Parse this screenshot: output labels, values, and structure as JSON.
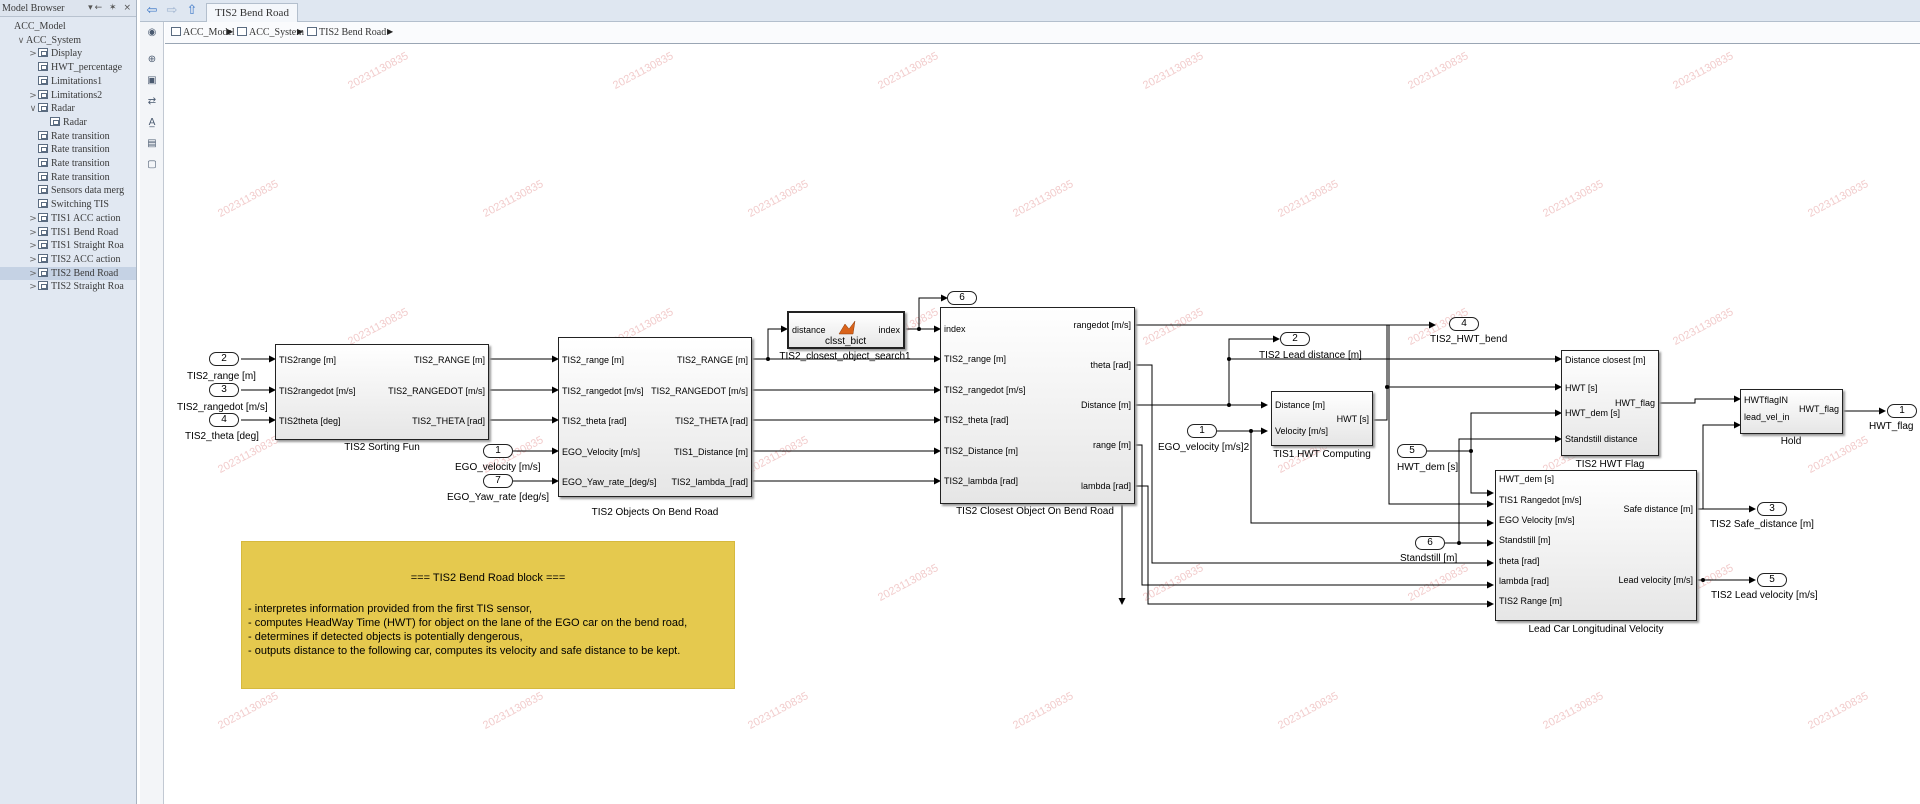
{
  "browser": {
    "title": "Model Browser",
    "controls": "▾← ✶ ×",
    "items": [
      {
        "label": "ACC_Model",
        "arrow": ""
      },
      {
        "label": "ACC_System",
        "arrow": "∨"
      },
      {
        "label": "Display",
        "arrow": ">"
      },
      {
        "label": "HWT_percentage",
        "arrow": ""
      },
      {
        "label": "Limitations1",
        "arrow": ""
      },
      {
        "label": "Limitations2",
        "arrow": ">"
      },
      {
        "label": "Radar",
        "arrow": "∨"
      },
      {
        "label": "Radar",
        "arrow": ""
      },
      {
        "label": "Rate transition",
        "arrow": ""
      },
      {
        "label": "Rate transition",
        "arrow": ""
      },
      {
        "label": "Rate transition",
        "arrow": ""
      },
      {
        "label": "Rate transition",
        "arrow": ""
      },
      {
        "label": "Sensors data merg",
        "arrow": ""
      },
      {
        "label": "Switching TIS",
        "arrow": ""
      },
      {
        "label": "TIS1 ACC action",
        "arrow": ">"
      },
      {
        "label": "TIS1 Bend Road",
        "arrow": ">"
      },
      {
        "label": "TIS1 Straight Roa",
        "arrow": ">"
      },
      {
        "label": "TIS2 ACC action",
        "arrow": ">"
      },
      {
        "label": "TIS2 Bend Road",
        "arrow": ">"
      },
      {
        "label": "TIS2 Straight Roa",
        "arrow": ">"
      }
    ]
  },
  "toolbar": {
    "back_icon": "⇦",
    "forward_icon": "⇨",
    "up_icon": "⇧",
    "tab_label": "TIS2 Bend Road"
  },
  "breadcrumb": {
    "items": [
      "ACC_Model",
      "ACC_System",
      "TIS2 Bend Road"
    ],
    "sep": "▶"
  },
  "tools": [
    "◉",
    "⊕",
    "▣",
    "⇄",
    "A̲",
    "▤",
    "▢"
  ],
  "watermark": "20231130835",
  "blocks": {
    "sorting": {
      "name": "TIS2 Sorting Fun",
      "inputs": [
        "TIS2range [m]",
        "TIS2rangedot [m/s]",
        "TIS2theta [deg]"
      ],
      "outputs": [
        "TIS2_RANGE [m]",
        "TIS2_RANGEDOT [m/s]",
        "TIS2_THETA [rad]"
      ]
    },
    "objects": {
      "name": "TIS2 Objects On Bend Road",
      "inputs": [
        "TIS2_range [m]",
        "TIS2_rangedot [m/s]",
        "TIS2_theta [rad]",
        "EGO_Velocity [m/s]",
        "EGO_Yaw_rate_[deg/s]"
      ],
      "outputs": [
        "TIS2_RANGE [m]",
        "TIS2_RANGEDOT [m/s]",
        "TIS2_THETA [rad]",
        "TIS1_Distance [m]",
        "TIS2_lambda_[rad]"
      ]
    },
    "search": {
      "name": "TIS2_closest_object_search1",
      "input": "distance",
      "output": "index",
      "label": "clsst_bict"
    },
    "closest": {
      "name": "TIS2 Closest Object On Bend Road",
      "inputs": [
        "index",
        "TIS2_range [m]",
        "TIS2_rangedot [m/s]",
        "TIS2_theta [rad]",
        "TIS2_Distance [m]",
        "TIS2_lambda [rad]"
      ],
      "outputs": [
        "rangedot [m/s]",
        "theta [rad]",
        "Distance [m]",
        "range [m]",
        "lambda [rad]"
      ]
    },
    "hwt_comp": {
      "name": "TIS1 HWT Computing",
      "inputs": [
        "Distance [m]",
        "Velocity [m/s]"
      ],
      "output": "HWT [s]"
    },
    "hwt_flag": {
      "name": "TIS2 HWT Flag",
      "inputs": [
        "Distance closest [m]",
        "HWT [s]",
        "HWT_dem [s]",
        "Standstill distance"
      ],
      "output": "HWT_flag"
    },
    "hold": {
      "name": "Hold",
      "inputs": [
        "HWTflagIN",
        "lead_vel_in"
      ],
      "output": "HWT_flag"
    },
    "lead": {
      "name": "Lead Car Longitudinal Velocity",
      "inputs": [
        "HWT_dem [s]",
        "TIS1 Rangedot [m/s]",
        "EGO Velocity [m/s]",
        "Standstill [m]",
        "theta [rad]",
        "lambda [rad]",
        "TIS2 Range [m]"
      ],
      "outputs": [
        "Safe distance [m]",
        "Lead velocity [m/s]"
      ]
    }
  },
  "ports": {
    "in_range": {
      "num": "2",
      "label": "TIS2_range [m]"
    },
    "in_rangedot": {
      "num": "3",
      "label": "TIS2_rangedot [m/s]"
    },
    "in_theta": {
      "num": "4",
      "label": "TIS2_theta [deg]"
    },
    "in_ego_vel": {
      "num": "1",
      "label": "EGO_velocity [m/s]"
    },
    "in_yaw": {
      "num": "7",
      "label": "EGO_Yaw_rate [deg/s]"
    },
    "out_6": {
      "num": "6"
    },
    "out_lead_dist": {
      "num": "2",
      "label": "TIS2 Lead distance [m]"
    },
    "out_hwt_bend": {
      "num": "4",
      "label": "TIS2_HWT_bend"
    },
    "in_ego_vel2": {
      "num": "1",
      "label": "EGO_velocity [m/s]2"
    },
    "in_hwt_dem": {
      "num": "5",
      "label": "HWT_dem [s]"
    },
    "in_standstill": {
      "num": "6",
      "label": "Standstill [m]"
    },
    "out_hwt_flag": {
      "num": "1",
      "label": "HWT_flag"
    },
    "out_safe": {
      "num": "3",
      "label": "TIS2 Safe_distance [m]"
    },
    "out_lead_vel": {
      "num": "5",
      "label": "TIS2 Lead velocity [m/s]"
    }
  },
  "note": {
    "title": "=== TIS2 Bend Road block ===",
    "lines": [
      "- interpretes information provided from the first TIS sensor,",
      "- computes HeadWay Time (HWT) for object on the lane of the EGO car on the bend road,",
      "- determines if detected objects is potentially dengerous,",
      "- outputs distance to the following car, computes its velocity and safe distance to be kept."
    ]
  }
}
